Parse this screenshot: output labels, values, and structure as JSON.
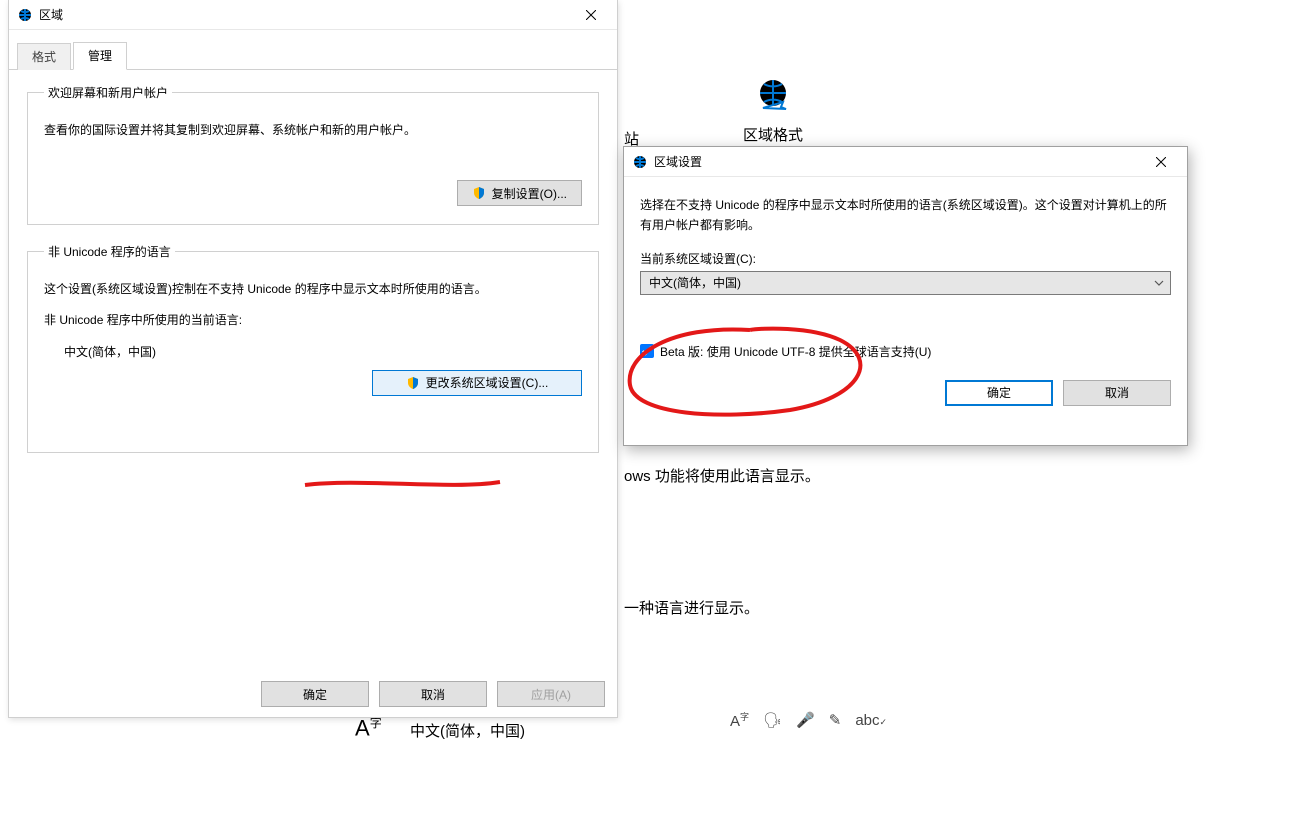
{
  "background": {
    "region_icon_label": "区域格式",
    "partial_label_left": "站",
    "text_windows_lang": "ows 功能将使用此语言显示。",
    "text_another_lang": "一种语言进行显示。",
    "lang_display": "中文(简体，中国)"
  },
  "region_dialog": {
    "title": "区域",
    "tabs": {
      "formats": "格式",
      "admin": "管理"
    },
    "group1": {
      "legend": "欢迎屏幕和新用户帐户",
      "desc": "查看你的国际设置并将其复制到欢迎屏幕、系统帐户和新的用户帐户。",
      "copy_btn": "复制设置(O)..."
    },
    "group2": {
      "legend": "非 Unicode 程序的语言",
      "desc": "这个设置(系统区域设置)控制在不支持 Unicode 的程序中显示文本时所使用的语言。",
      "current_label": "非 Unicode 程序中所使用的当前语言:",
      "current_value": "中文(简体，中国)",
      "change_btn": "更改系统区域设置(C)..."
    },
    "buttons": {
      "ok": "确定",
      "cancel": "取消",
      "apply": "应用(A)"
    }
  },
  "settings_dialog": {
    "title": "区域设置",
    "desc": "选择在不支持 Unicode 的程序中显示文本时所使用的语言(系统区域设置)。这个设置对计算机上的所有用户帐户都有影响。",
    "combo_label": "当前系统区域设置(C):",
    "combo_value": "中文(简体，中国)",
    "checkbox_label": "Beta 版: 使用 Unicode UTF-8 提供全球语言支持(U)",
    "checkbox_checked": true,
    "ok": "确定",
    "cancel": "取消"
  }
}
